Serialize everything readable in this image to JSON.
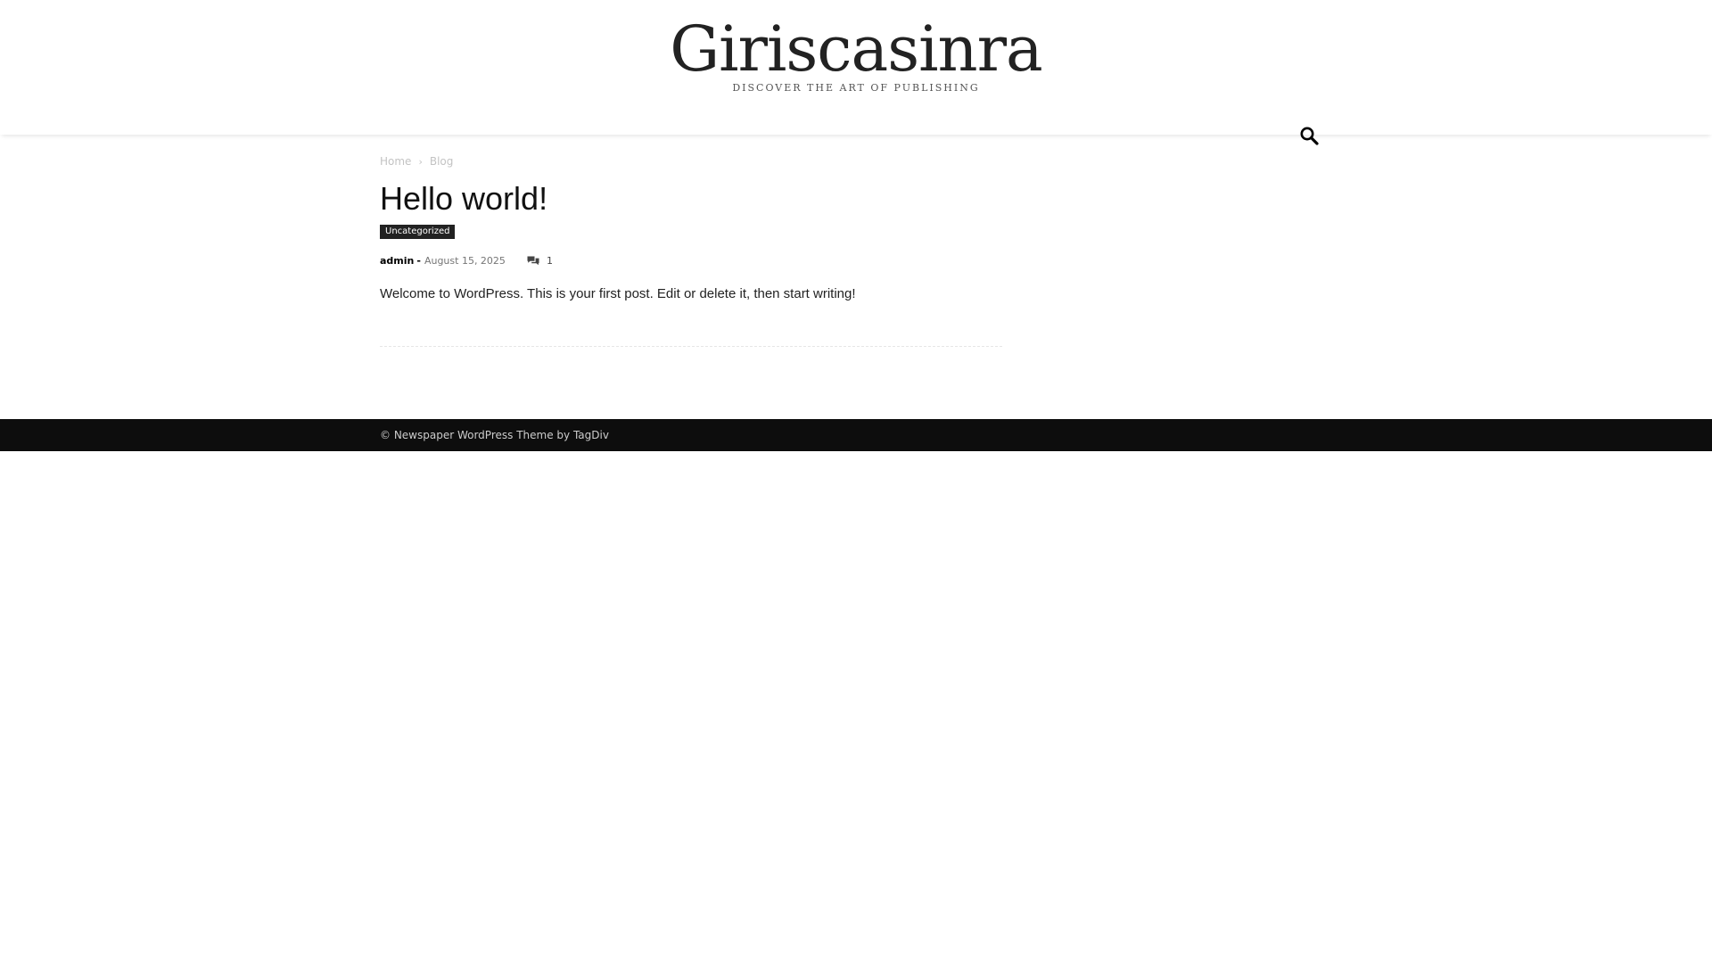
{
  "header": {
    "site_title": "Giriscasinra",
    "tagline": "DISCOVER THE ART OF PUBLISHING",
    "search_icon": "search-icon"
  },
  "breadcrumb": {
    "items": [
      {
        "label": "Home"
      },
      {
        "label": "Blog"
      }
    ],
    "separator": "›"
  },
  "post": {
    "title": "Hello world!",
    "category": "Uncategorized",
    "author": "admin",
    "author_separator": "-",
    "date": "August 15, 2025",
    "comment_icon": "comment-icon",
    "comment_count": "1",
    "content": "Welcome to WordPress. This is your first post. Edit or delete it, then start writing!"
  },
  "footer": {
    "copyright": "© Newspaper WordPress Theme by TagDiv"
  },
  "colors": {
    "footer_background": "#0d0d0d",
    "category_background": "#222222",
    "breadcrumb_text": "#c3c3c3"
  }
}
